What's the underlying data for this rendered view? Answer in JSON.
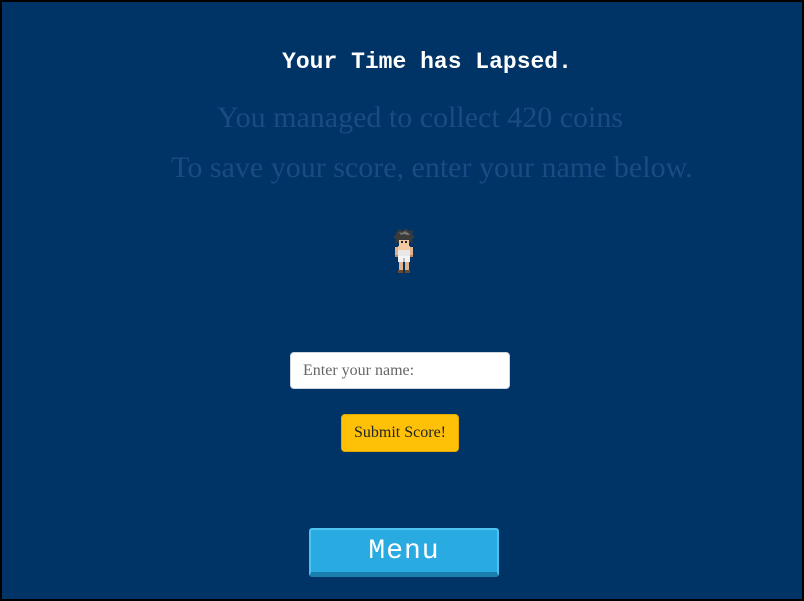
{
  "game_over": {
    "title": "Your Time has Lapsed.",
    "coins_message": "You managed to collect 420 coins",
    "save_prompt": "To save your score, enter your name below."
  },
  "player_sprite": {
    "icon": "character-sprite-icon"
  },
  "name_form": {
    "placeholder": "Enter your name:",
    "value": "",
    "submit_label": "Submit Score!",
    "submit_color": "#ffc107"
  },
  "menu_button": {
    "label": "Menu",
    "color": "#29abe2"
  },
  "colors": {
    "background": "#003366",
    "faded_text": "#1a4b84"
  }
}
